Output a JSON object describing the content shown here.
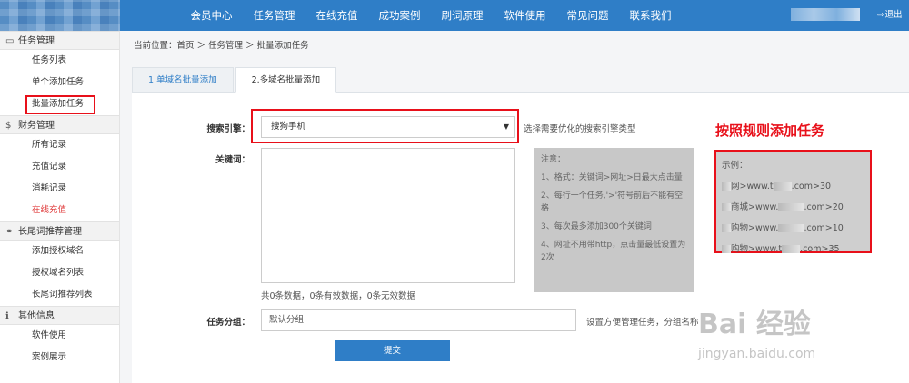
{
  "header": {
    "nav": [
      "会员中心",
      "任务管理",
      "在线充值",
      "成功案例",
      "刷词原理",
      "软件使用",
      "常见问题",
      "联系我们"
    ],
    "logout": "退出"
  },
  "sidebar": {
    "sections": [
      {
        "title": "任务管理",
        "icon": "folder-icon",
        "items": [
          "任务列表",
          "单个添加任务",
          "批量添加任务"
        ]
      },
      {
        "title": "财务管理",
        "icon": "dollar-icon",
        "items": [
          "所有记录",
          "充值记录",
          "消耗记录",
          "在线充值"
        ]
      },
      {
        "title": "长尾词推荐管理",
        "icon": "link-icon",
        "items": [
          "添加授权域名",
          "授权域名列表",
          "长尾词推荐列表"
        ]
      },
      {
        "title": "其他信息",
        "icon": "info-icon",
        "items": [
          "软件使用",
          "案例展示"
        ]
      }
    ]
  },
  "breadcrumb": "当前位置：首页 ＞ 任务管理 ＞ 批量添加任务",
  "tabs": [
    "1.单域名批量添加",
    "2.多域名批量添加"
  ],
  "form": {
    "engine_label": "搜索引擎：",
    "engine_value": "搜狗手机",
    "engine_hint": "选择需要优化的搜索引擎类型",
    "keyword_label": "关键词：",
    "counts": "共0条数据，0条有效数据，0条无效数据",
    "group_label": "任务分组：",
    "group_placeholder": "默认分组",
    "group_hint": "设置方便管理任务，分组名称",
    "submit": "提交"
  },
  "notice": {
    "title": "注意：",
    "items": [
      "1、格式：关键词>网址>日最大点击量",
      "2、每行一个任务,'>'符号前后不能有空格",
      "3、每次最多添加300个关键词",
      "4、网址不用带http，点击量最低设置为2次"
    ]
  },
  "annotation": {
    "title": "按照规则添加任务",
    "example_title": "示例：",
    "example_lines": [
      {
        "kw": "网",
        "url": ">www.t",
        "end": ".com>30"
      },
      {
        "kw": "商城",
        "url": ">www.",
        "end": ".com>20"
      },
      {
        "kw": "购物",
        "url": ">www.",
        "end": ".com>10"
      },
      {
        "kw": "购物",
        "url": ">www.t",
        "end": ".com>35"
      }
    ]
  },
  "watermark": {
    "big": "Bai 经验",
    "small": "jingyan.baidu.com"
  }
}
